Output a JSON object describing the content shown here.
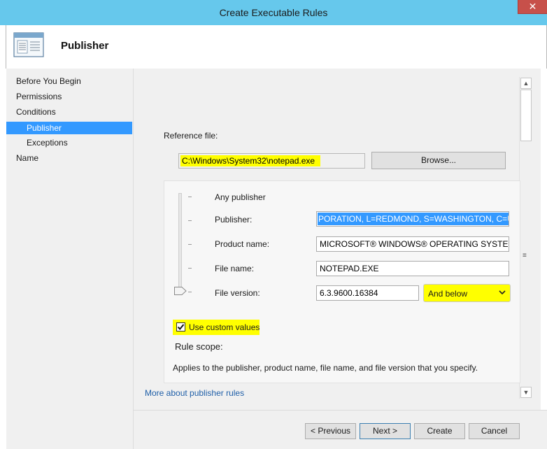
{
  "window": {
    "title": "Create Executable Rules",
    "close_glyph": "✕"
  },
  "header": {
    "title": "Publisher",
    "icon": "wizard-page-icon"
  },
  "nav": {
    "items": [
      {
        "label": "Before You Begin",
        "selected": false,
        "indent": false
      },
      {
        "label": "Permissions",
        "selected": false,
        "indent": false
      },
      {
        "label": "Conditions",
        "selected": false,
        "indent": false
      },
      {
        "label": "Publisher",
        "selected": true,
        "indent": true
      },
      {
        "label": "Exceptions",
        "selected": false,
        "indent": true
      },
      {
        "label": "Name",
        "selected": false,
        "indent": false
      }
    ]
  },
  "reference": {
    "label": "Reference file:",
    "path": "C:\\Windows\\System32\\notepad.exe",
    "browse_label": "Browse..."
  },
  "slider": {
    "levels": [
      "Any publisher",
      "Publisher:",
      "Product name:",
      "File name:",
      "File version:"
    ],
    "selected_level": "File version:"
  },
  "fields": {
    "publisher": "PORATION, L=REDMOND, S=WASHINGTON, C=US",
    "product_name": "MICROSOFT® WINDOWS® OPERATING SYSTEM",
    "file_name": "NOTEPAD.EXE",
    "file_version": "6.3.9600.16384",
    "version_option": "And below"
  },
  "custom_values": {
    "label": "Use custom values",
    "checked": true
  },
  "rule_scope": {
    "title": "Rule scope:",
    "text": "Applies to the publisher, product name, file name, and file version that you specify."
  },
  "more_link": "More about publisher rules",
  "buttons": {
    "previous": "< Previous",
    "next": "Next >",
    "create": "Create",
    "cancel": "Cancel"
  },
  "colors": {
    "titlebar": "#66c8ec",
    "selection": "#3399ff",
    "highlight": "#ffff00",
    "close": "#c7504a"
  }
}
